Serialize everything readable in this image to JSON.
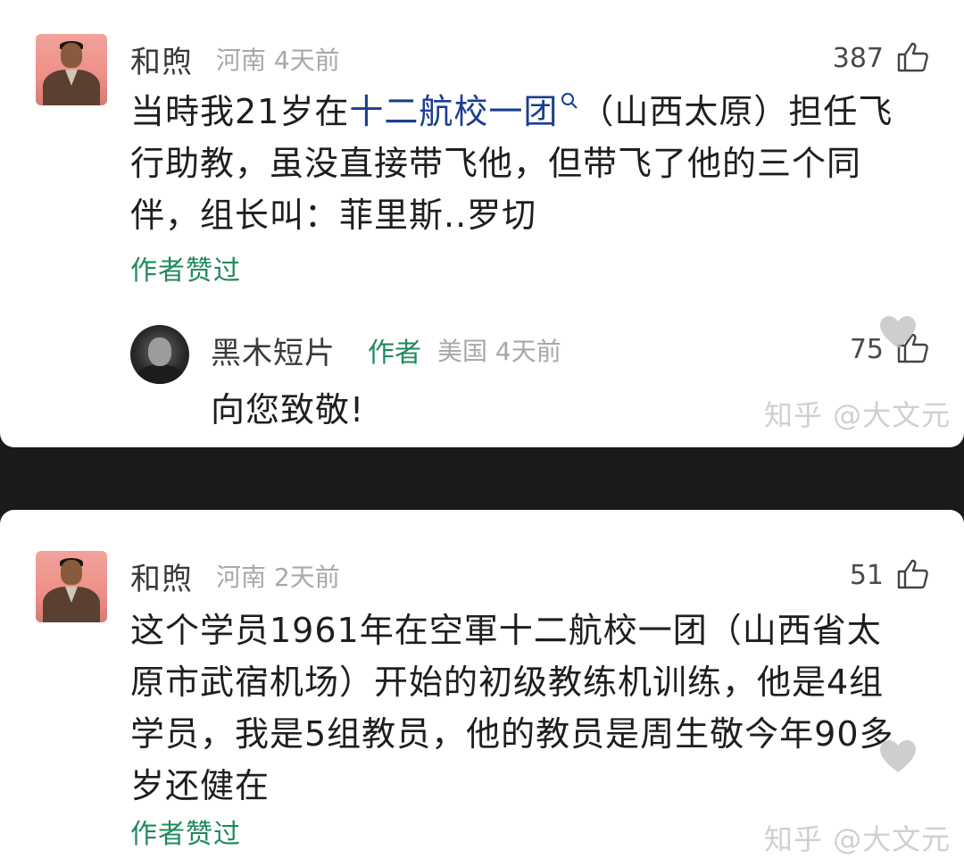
{
  "comment1": {
    "user": "和煦",
    "location": "河南",
    "time": "4天前",
    "likes": "387",
    "content_line1_pre": "当時我21岁在",
    "content_link": "十二航校一团",
    "content_line1_post": "（山西太原）担任飞",
    "content_line2": "行助教，虽没直接带飞他，但带飞了他的三个同",
    "content_line3": "伴，组长叫：菲里斯..罗切",
    "liked_by_author": "作者赞过",
    "reply": {
      "user": "黑木短片",
      "badge": "作者",
      "location": "美国",
      "time": "4天前",
      "likes": "75",
      "content": "向您致敬!"
    },
    "watermark": "知乎 @大文元"
  },
  "comment2": {
    "user": "和煦",
    "location": "河南",
    "time": "2天前",
    "likes": "51",
    "content_line1": "这个学员1961年在空軍十二航校一团（山西省太",
    "content_line2": "原市武宿机场）开始的初级教练机训练，他是4组",
    "content_line3": "学员，我是5组教员，他的教员是周生敬今年90多",
    "content_line4": "岁还健在",
    "liked_by_author": "作者赞过",
    "watermark": "知乎 @大文元"
  }
}
